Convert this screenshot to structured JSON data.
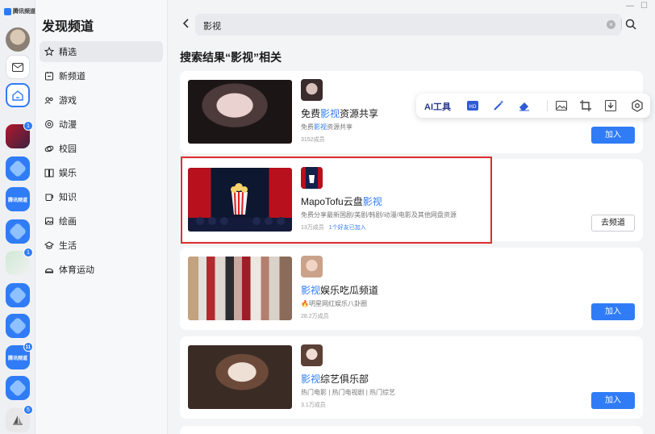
{
  "app": {
    "name": "腾讯频道"
  },
  "rail": {
    "badges": [
      "1",
      "1",
      "11",
      "5"
    ]
  },
  "sidebar": {
    "title": "发现频道",
    "items": [
      {
        "label": "精选",
        "icon": "star-icon"
      },
      {
        "label": "新频道",
        "icon": "new-channel-icon"
      },
      {
        "label": "游戏",
        "icon": "gamepad-icon"
      },
      {
        "label": "动漫",
        "icon": "anime-icon"
      },
      {
        "label": "校园",
        "icon": "campus-icon"
      },
      {
        "label": "娱乐",
        "icon": "book-icon"
      },
      {
        "label": "知识",
        "icon": "knowledge-icon"
      },
      {
        "label": "绘画",
        "icon": "painting-icon"
      },
      {
        "label": "生活",
        "icon": "life-icon"
      },
      {
        "label": "体育运动",
        "icon": "sports-icon"
      }
    ]
  },
  "search": {
    "value": "影视"
  },
  "results": {
    "heading": "搜索结果“影视”相关",
    "cards": [
      {
        "name_pre": "免费",
        "name_hl": "影视",
        "name_post": "资源共享",
        "desc_pre": "免费",
        "desc_hl": "影视",
        "desc_post": "资源共享",
        "members": "3152成员",
        "friends": "",
        "action": "加入"
      },
      {
        "name_pre": "MapoTofu云盘",
        "name_hl": "影视",
        "name_post": "",
        "desc_pre": "免费分享最新国剧/美剧/韩剧/动漫/电影及其他网盘资源",
        "desc_hl": "",
        "desc_post": "",
        "members": "13万成员",
        "friends": "1个好友已加入",
        "action": "去频道"
      },
      {
        "name_pre": "",
        "name_hl": "影视",
        "name_post": "娱乐吃瓜频道",
        "desc_pre": "🔥明星网红娱乐八卦圈",
        "desc_hl": "",
        "desc_post": "",
        "members": "28.2万成员",
        "friends": "",
        "action": "加入"
      },
      {
        "name_pre": "",
        "name_hl": "影视",
        "name_post": "综艺俱乐部",
        "desc_pre": "热门电影 | 热门电视剧 | 热门综艺",
        "desc_hl": "",
        "desc_post": "",
        "members": "3.1万成员",
        "friends": "",
        "action": "加入"
      }
    ]
  },
  "toolbar": {
    "ai_label": "AI工具"
  },
  "colors": {
    "accent": "#2f7cf6",
    "highlight_box": "#e02e2e"
  }
}
